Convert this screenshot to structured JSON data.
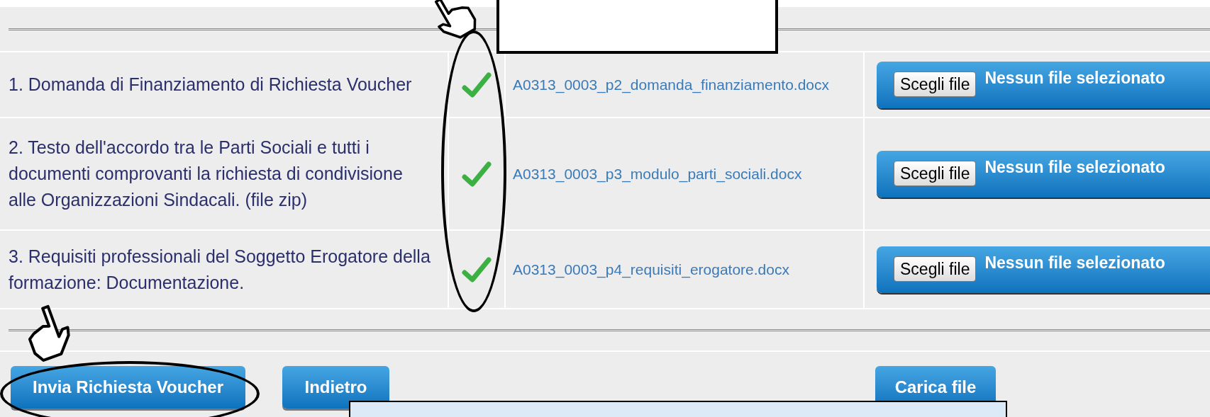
{
  "documents": [
    {
      "description": "1. Domanda di Finanziamento di Richiesta Voucher",
      "checked": true,
      "file_link": "A0313_0003_p2_domanda_finanziamento.docx",
      "choose_button": "Scegli file",
      "file_status": "Nessun file selezionato"
    },
    {
      "description": "2. Testo dell'accordo tra le Parti Sociali e tutti i documenti comprovanti la richiesta di condivisione alle Organizzazioni Sindacali. (file zip)",
      "checked": true,
      "file_link": "A0313_0003_p3_modulo_parti_sociali.docx",
      "choose_button": "Scegli file",
      "file_status": "Nessun file selezionato"
    },
    {
      "description": "3. Requisiti professionali del Soggetto Erogatore della formazione: Documentazione.",
      "checked": true,
      "file_link": "A0313_0003_p4_requisiti_erogatore.docx",
      "choose_button": "Scegli file",
      "file_status": "Nessun file selezionato"
    }
  ],
  "buttons": {
    "submit": "Invia Richiesta Voucher",
    "back": "Indietro",
    "upload": "Carica file"
  }
}
